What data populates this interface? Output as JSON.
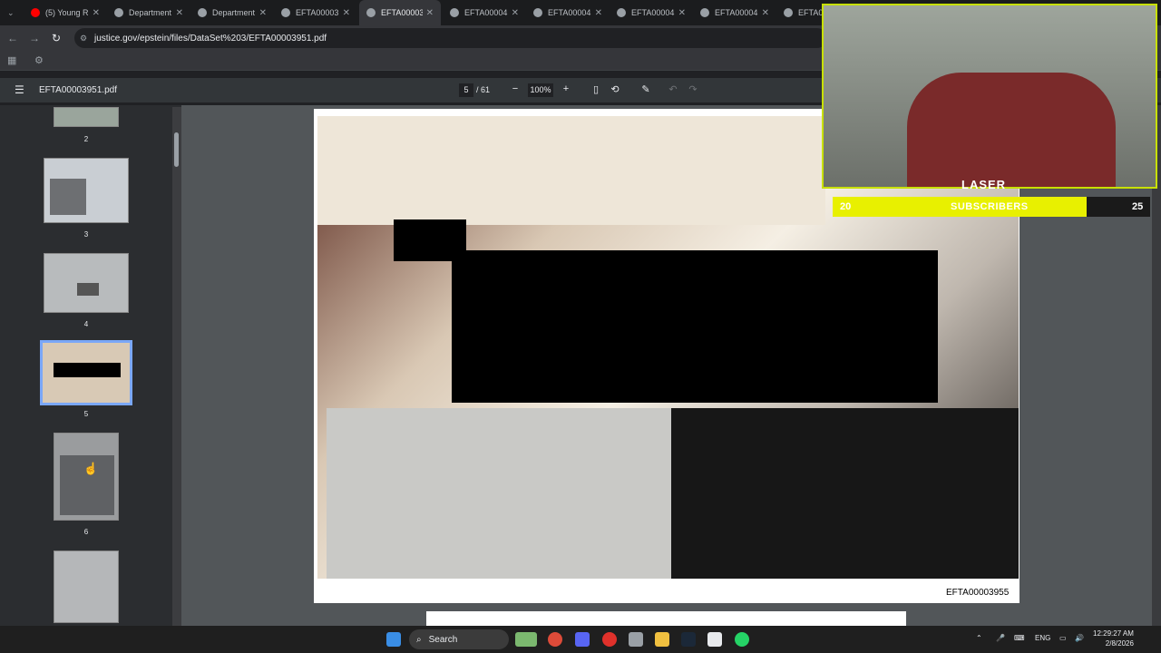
{
  "tabs": [
    {
      "title": "(5) Young R",
      "active": false
    },
    {
      "title": "Department",
      "active": false
    },
    {
      "title": "Department",
      "active": false
    },
    {
      "title": "EFTA00003",
      "active": false
    },
    {
      "title": "EFTA00003",
      "active": true
    },
    {
      "title": "EFTA00004",
      "active": false
    },
    {
      "title": "EFTA00004",
      "active": false
    },
    {
      "title": "EFTA00004",
      "active": false
    },
    {
      "title": "EFTA00004",
      "active": false
    },
    {
      "title": "EFTA00",
      "active": false
    }
  ],
  "address": {
    "url": "justice.gov/epstein/files/DataSet%203/EFTA00003951.pdf"
  },
  "pdf": {
    "file_name": "EFTA00003951.pdf",
    "current_page": "5",
    "total_pages": "/ 61",
    "zoom": "100%",
    "page_label": "EFTA00003955"
  },
  "thumbnails": [
    {
      "label": "2",
      "selected": false
    },
    {
      "label": "3",
      "selected": false
    },
    {
      "label": "4",
      "selected": false
    },
    {
      "label": "5",
      "selected": true
    },
    {
      "label": "6",
      "selected": false
    }
  ],
  "overlay": {
    "logo": "LASER",
    "subscribers_current": "20",
    "subscribers_label": "SUBSCRIBERS",
    "subscribers_goal": "25",
    "progress": 0.8
  },
  "taskbar": {
    "search_label": "Search",
    "lang": "ENG",
    "time": "12:29:27 AM",
    "date": "2/8/2026"
  },
  "colors": {
    "accent": "#7aa7f7",
    "overlay_bar": "#e8f000"
  }
}
